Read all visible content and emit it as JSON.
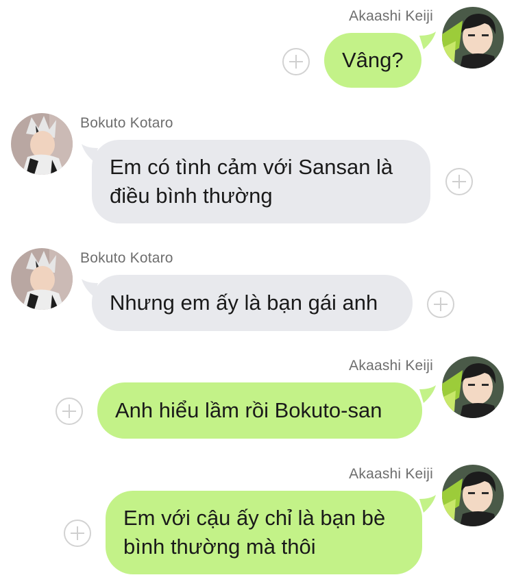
{
  "messages": [
    {
      "sender": "Akaashi Keiji",
      "direction": "outgoing",
      "text": "Vâng?"
    },
    {
      "sender": "Bokuto Kotaro",
      "direction": "incoming",
      "text": "Em có tình cảm với Sansan là\nđiều bình thường"
    },
    {
      "sender": "Bokuto Kotaro",
      "direction": "incoming",
      "text": "Nhưng em ấy là bạn gái anh"
    },
    {
      "sender": "Akaashi Keiji",
      "direction": "outgoing",
      "text": "Anh hiểu lầm rồi Bokuto-san"
    },
    {
      "sender": "Akaashi Keiji",
      "direction": "outgoing",
      "text": "Em với cậu ấy chỉ là bạn bè\nbình thường mà thôi"
    }
  ],
  "colors": {
    "outgoing_bubble": "#c3f288",
    "incoming_bubble": "#e8e9ed",
    "sender_name": "#6e6e6e",
    "add_button": "#d2d2d2"
  },
  "icons": {
    "add": "plus-circle-icon"
  }
}
